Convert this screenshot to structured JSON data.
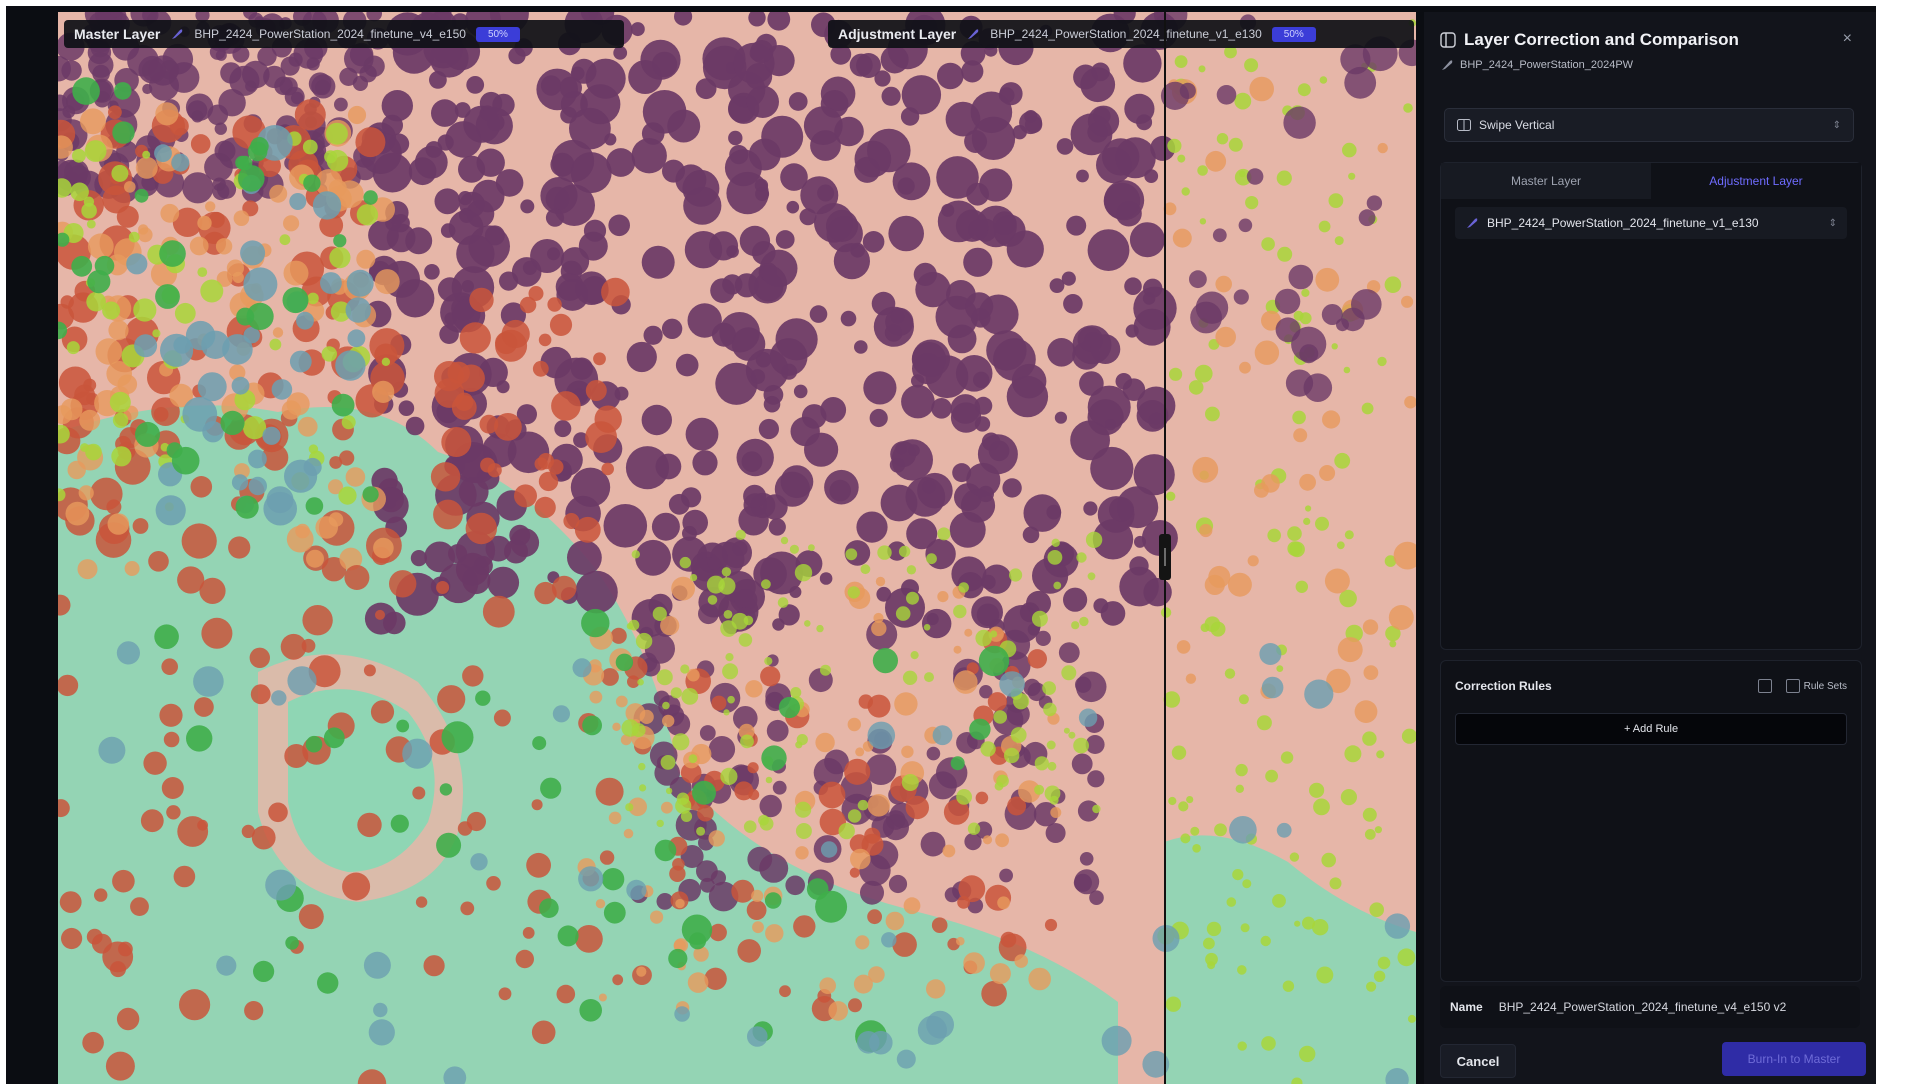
{
  "left_header": {
    "title": "Master Layer",
    "model": "BHP_2424_PowerStation_2024_finetune_v4_e150",
    "opacity": "50%"
  },
  "right_header": {
    "title": "Adjustment Layer",
    "model": "BHP_2424_PowerStation_2024_finetune_v1_e130",
    "opacity": "50%"
  },
  "panel": {
    "title": "Layer Correction and Comparison",
    "subtitle": "BHP_2424_PowerStation_2024PW",
    "close_icon": "×",
    "mode": "Swipe Vertical",
    "tabs": [
      "Master Layer",
      "Adjustment Layer"
    ],
    "selected_layer": "BHP_2424_PowerStation_2024_finetune_v1_e130",
    "rules_title": "Correction Rules",
    "rule_sets_label": "Rule Sets",
    "add_rule_label": "+ Add Rule",
    "name_label": "Name",
    "name_value": "BHP_2424_PowerStation_2024_finetune_v4_e150 v2",
    "cancel_label": "Cancel",
    "burn_label": "Burn-In to Master"
  },
  "colors": {
    "accent": "#3b3dd8",
    "tab_active": "#6f6cff",
    "ground": "#e6b6a8",
    "trees_purple": "#6b3a66",
    "water_mint": "#8fd6b4",
    "orange": "#e79a5c",
    "red": "#c9553b",
    "lime": "#a8d63a",
    "green": "#3fae4a",
    "teal_blue": "#6c9fb0"
  },
  "icons": {
    "feather": "feather-icon",
    "panel": "panel-icon",
    "swipe": "swipe-icon",
    "chevron": "chevron-icon",
    "close": "close-icon"
  }
}
